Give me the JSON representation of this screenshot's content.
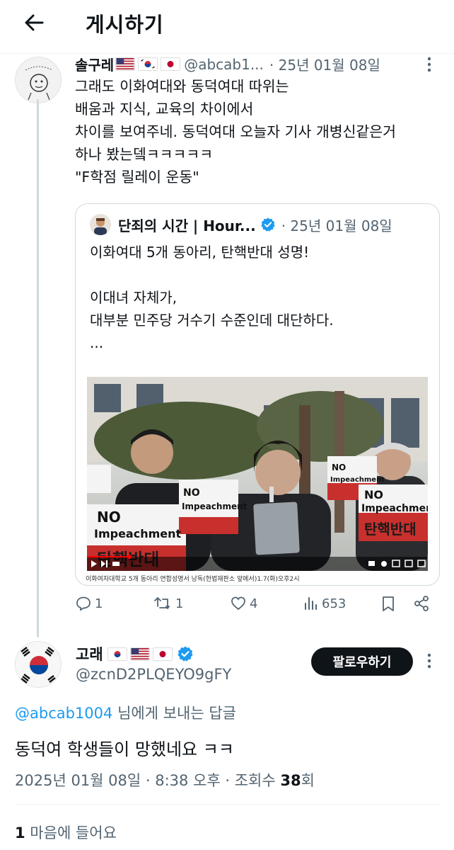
{
  "header": {
    "title": "게시하기"
  },
  "original_tweet": {
    "author_name": "솔구레",
    "handle": "@abcab1...",
    "date": "· 25년 01월 08일",
    "text": "그래도 이화여대와 동덕여대 따위는\n배움과 지식, 교육의 차이에서\n차이를 보여주네. 동덕여대 오늘자 기사 개병신같은거\n하나 봤는뎈ㅋㅋㅋㅋㅋ\n\"F학점 릴레이 운동\"",
    "quoted": {
      "author_name": "단죄의 시간 | Hour...",
      "date": "· 25년 01월 08일",
      "text": "이화여대 5개 동아리, 탄핵반대 성명!\n\n이대녀 자체가,\n대부분 민주당 거수기 수준인데 대단하다.\n...",
      "image_caption": "이화여자대학교 5개 동아리 연합성명서 낭독(헌법재판소 앞에서)1.7(화)오후2시",
      "sign_text_1": "NO",
      "sign_text_2": "Impeachment",
      "sign_text_3": "탄핵반대"
    },
    "stats": {
      "replies": "1",
      "retweets": "1",
      "likes": "4",
      "views": "653"
    }
  },
  "reply_tweet": {
    "author_name": "고래",
    "handle": "@zcnD2PLQEYO9gFY",
    "follow_label": "팔로우하기",
    "replying_to": "@abcab1004",
    "replying_suffix": " 님에게 보내는 답글",
    "text": "동덕여 학생들이 망했네요 ㅋㅋ",
    "meta_prefix": "2025년 01월 08일 · 8:38 오후 · 조회수 ",
    "views": "38",
    "meta_suffix": "회",
    "likes_count": "1",
    "likes_label": " 마음에 들어요"
  },
  "colors": {
    "accent": "#1d9bf0",
    "text": "#0f1419",
    "secondary": "#536471",
    "sign_red": "#d62b2b"
  },
  "icons": [
    "back-arrow-icon",
    "more-icon",
    "verified-icon",
    "reply-icon",
    "retweet-icon",
    "like-icon",
    "views-icon",
    "bookmark-icon",
    "share-icon",
    "flag-icon"
  ]
}
